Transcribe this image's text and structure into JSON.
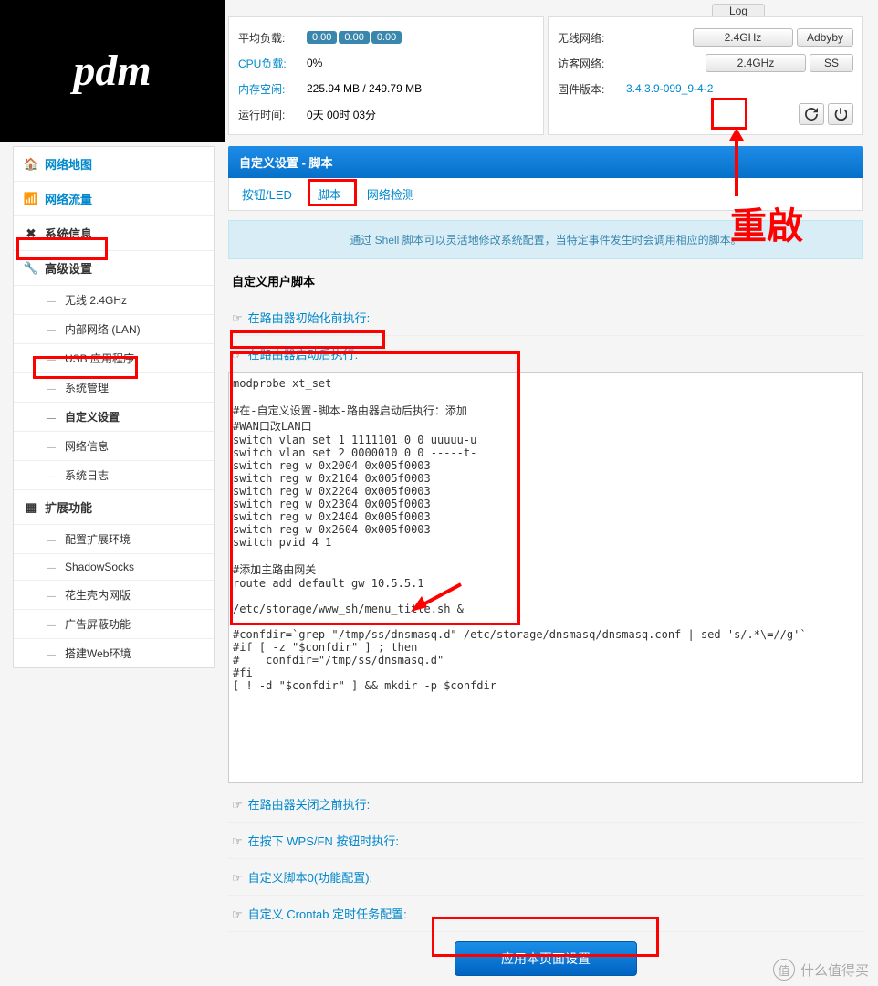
{
  "log_link": "Log",
  "logo": "pdm",
  "status_left": {
    "avg_load": {
      "label": "平均负载:",
      "v1": "0.00",
      "v2": "0.00",
      "v3": "0.00"
    },
    "cpu_load": {
      "label": "CPU负载:",
      "value": "0%"
    },
    "mem_free": {
      "label": "内存空闲:",
      "value": "225.94 MB / 249.79 MB"
    },
    "uptime": {
      "label": "运行时间:",
      "value": "0天 00时 03分"
    }
  },
  "status_right": {
    "wireless": {
      "label": "无线网络:",
      "btn1": "2.4GHz",
      "btn2": "Adbyby"
    },
    "guest": {
      "label": "访客网络:",
      "btn1": "2.4GHz",
      "btn2": "SS"
    },
    "firmware": {
      "label": "固件版本:",
      "value": "3.4.3.9-099_9-4-2"
    }
  },
  "sidebar": {
    "map": "网络地图",
    "traffic": "网络流量",
    "sysinfo": "系统信息",
    "advanced": "高级设置",
    "adv_items": [
      "无线 2.4GHz",
      "内部网络 (LAN)",
      "USB 应用程序",
      "系统管理",
      "自定义设置",
      "网络信息",
      "系统日志"
    ],
    "ext": "扩展功能",
    "ext_items": [
      "配置扩展环境",
      "ShadowSocks",
      "花生壳内网版",
      "广告屏蔽功能",
      "搭建Web环境"
    ]
  },
  "page": {
    "title": "自定义设置 - 脚本",
    "tabs": [
      "按钮/LED",
      "脚本",
      "网络检测"
    ],
    "info": "通过 Shell 脚本可以灵活地修改系统配置，当特定事件发生时会调用相应的脚本。",
    "section": "自定义用户脚本",
    "acc1": "在路由器初始化前执行:",
    "acc2": "在路由器启动后执行:",
    "script": "modprobe xt_set\n\n#在-自定义设置-脚本-路由器启动后执行：添加\n#WAN口改LAN口\nswitch vlan set 1 1111101 0 0 uuuuu-u\nswitch vlan set 2 0000010 0 0 -----t-\nswitch reg w 0x2004 0x005f0003\nswitch reg w 0x2104 0x005f0003\nswitch reg w 0x2204 0x005f0003\nswitch reg w 0x2304 0x005f0003\nswitch reg w 0x2404 0x005f0003\nswitch reg w 0x2604 0x005f0003\nswitch pvid 4 1\n\n#添加主路由网关\nroute add default gw 10.5.5.1\n\n/etc/storage/www_sh/menu_title.sh &\n\n#confdir=`grep \"/tmp/ss/dnsmasq.d\" /etc/storage/dnsmasq/dnsmasq.conf | sed 's/.*\\=//g'`\n#if [ -z \"$confdir\" ] ; then\n#    confdir=\"/tmp/ss/dnsmasq.d\"\n#fi\n[ ! -d \"$confdir\" ] && mkdir -p $confdir\n",
    "acc3": "在路由器关闭之前执行:",
    "acc4": "在按下 WPS/FN 按钮时执行:",
    "acc5": "自定义脚本0(功能配置):",
    "acc6": "自定义 Crontab 定时任务配置:",
    "apply": "应用本页面设置"
  },
  "annotation": {
    "restart": "重啟"
  },
  "watermark": {
    "badge": "值",
    "text": "什么值得买"
  }
}
